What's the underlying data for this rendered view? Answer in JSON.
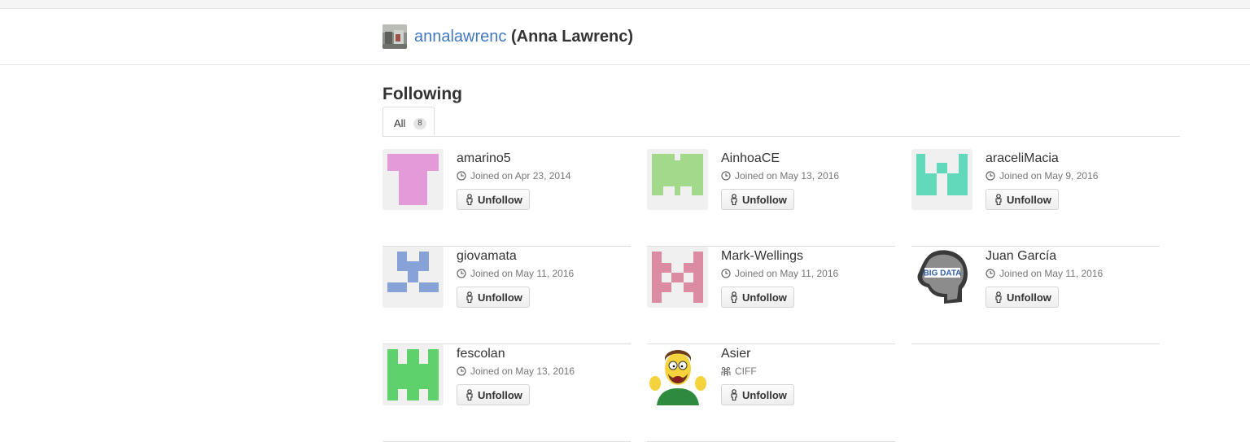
{
  "header": {
    "login": "annalawrenc",
    "full_name": "(Anna Lawrenc)"
  },
  "main": {
    "heading": "Following",
    "tabs": [
      {
        "label": "All",
        "count": "8"
      }
    ]
  },
  "users": [
    {
      "name": "amarino5",
      "meta": "Joined on Apr 23, 2014",
      "meta_icon": "clock-icon",
      "button": "Unfollow",
      "avatar": "identicon",
      "avatar_color": "#e39ad8"
    },
    {
      "name": "AinhoaCE",
      "meta": "Joined on May 13, 2016",
      "meta_icon": "clock-icon",
      "button": "Unfollow",
      "avatar": "identicon",
      "avatar_color": "#a3d98a"
    },
    {
      "name": "araceliMacia",
      "meta": "Joined on May 9, 2016",
      "meta_icon": "clock-icon",
      "button": "Unfollow",
      "avatar": "identicon",
      "avatar_color": "#62d9bb"
    },
    {
      "name": "giovamata",
      "meta": "Joined on May 11, 2016",
      "meta_icon": "clock-icon",
      "button": "Unfollow",
      "avatar": "identicon",
      "avatar_color": "#86a2d6"
    },
    {
      "name": "Mark-Wellings",
      "meta": "Joined on May 11, 2016",
      "meta_icon": "clock-icon",
      "button": "Unfollow",
      "avatar": "identicon",
      "avatar_color": "#db8ba2"
    },
    {
      "name": "Juan García",
      "meta": "Joined on May 11, 2016",
      "meta_icon": "clock-icon",
      "button": "Unfollow",
      "avatar": "word-cloud-head",
      "avatar_text": "BIG DATA"
    },
    {
      "name": "fescolan",
      "meta": "Joined on May 13, 2016",
      "meta_icon": "clock-icon",
      "button": "Unfollow",
      "avatar": "identicon",
      "avatar_color": "#5fd16a"
    },
    {
      "name": "Asier",
      "meta": "CIFF",
      "meta_icon": "organization-icon",
      "button": "Unfollow",
      "avatar": "cartoon-character"
    }
  ],
  "colors": {
    "link": "#4078c0",
    "text": "#333333",
    "muted": "#767676",
    "border": "#dddddd"
  }
}
